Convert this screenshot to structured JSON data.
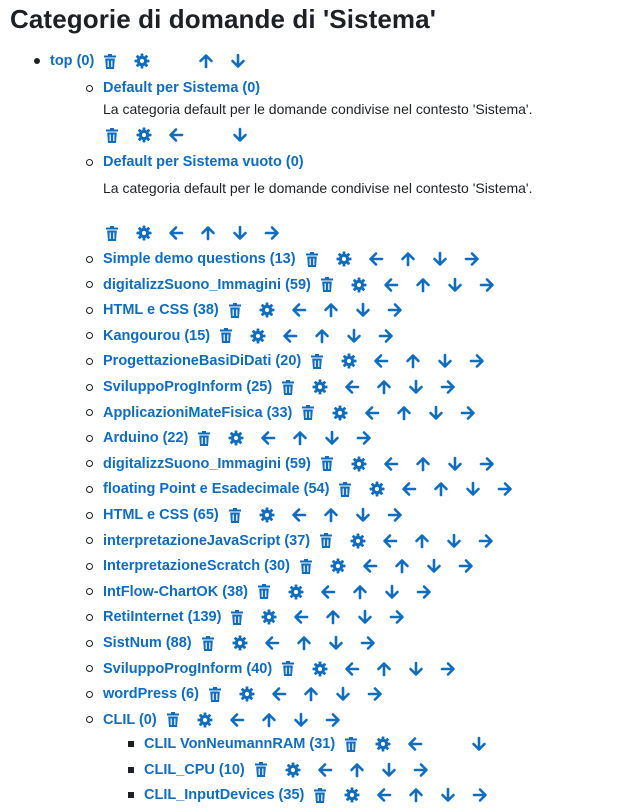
{
  "page": {
    "title": "Categorie di domande di 'Sistema'"
  },
  "colors": {
    "link": "#0f6cbf",
    "text": "#1d2125"
  },
  "top": {
    "label": "top (0)",
    "actions": [
      "delete",
      "settings",
      "",
      "up",
      "down"
    ]
  },
  "defaults": [
    {
      "label": "Default per Sistema (0)",
      "description": "La categoria default per le domande condivise nel contesto 'Sistema'.",
      "actions": [
        "delete",
        "settings",
        "left",
        "",
        "down"
      ]
    },
    {
      "label": "Default per Sistema vuoto (0)",
      "description": "La categoria default per le domande condivise nel contesto 'Sistema'.",
      "actions": [
        "delete",
        "settings",
        "left",
        "up",
        "down",
        "right"
      ]
    }
  ],
  "categories": [
    {
      "label": "Simple demo questions (13)",
      "actions": [
        "delete",
        "settings",
        "left",
        "up",
        "down",
        "right"
      ]
    },
    {
      "label": "digitalizzSuono_Immagini (59)",
      "actions": [
        "delete",
        "settings",
        "left",
        "up",
        "down",
        "right"
      ]
    },
    {
      "label": "HTML e CSS (38)",
      "actions": [
        "delete",
        "settings",
        "left",
        "up",
        "down",
        "right"
      ]
    },
    {
      "label": "Kangourou (15)",
      "actions": [
        "delete",
        "settings",
        "left",
        "up",
        "down",
        "right"
      ]
    },
    {
      "label": "ProgettazioneBasiDiDati (20)",
      "actions": [
        "delete",
        "settings",
        "left",
        "up",
        "down",
        "right"
      ]
    },
    {
      "label": "SviluppoProgInform (25)",
      "actions": [
        "delete",
        "settings",
        "left",
        "up",
        "down",
        "right"
      ]
    },
    {
      "label": "ApplicazioniMateFisica (33)",
      "actions": [
        "delete",
        "settings",
        "left",
        "up",
        "down",
        "right"
      ]
    },
    {
      "label": "Arduino (22)",
      "actions": [
        "delete",
        "settings",
        "left",
        "up",
        "down",
        "right"
      ]
    },
    {
      "label": "digitalizzSuono_Immagini (59)",
      "actions": [
        "delete",
        "settings",
        "left",
        "up",
        "down",
        "right"
      ]
    },
    {
      "label": "floating Point e Esadecimale (54)",
      "actions": [
        "delete",
        "settings",
        "left",
        "up",
        "down",
        "right"
      ]
    },
    {
      "label": "HTML e CSS (65)",
      "actions": [
        "delete",
        "settings",
        "left",
        "up",
        "down",
        "right"
      ]
    },
    {
      "label": "interpretazioneJavaScript (37)",
      "actions": [
        "delete",
        "settings",
        "left",
        "up",
        "down",
        "right"
      ]
    },
    {
      "label": "InterpretazioneScratch (30)",
      "actions": [
        "delete",
        "settings",
        "left",
        "up",
        "down",
        "right"
      ]
    },
    {
      "label": "IntFlow-ChartOK (38)",
      "actions": [
        "delete",
        "settings",
        "left",
        "up",
        "down",
        "right"
      ]
    },
    {
      "label": "RetiInternet (139)",
      "actions": [
        "delete",
        "settings",
        "left",
        "up",
        "down",
        "right"
      ]
    },
    {
      "label": "SistNum (88)",
      "actions": [
        "delete",
        "settings",
        "left",
        "up",
        "down",
        "right"
      ]
    },
    {
      "label": "SviluppoProgInform (40)",
      "actions": [
        "delete",
        "settings",
        "left",
        "up",
        "down",
        "right"
      ]
    },
    {
      "label": "wordPress (6)",
      "actions": [
        "delete",
        "settings",
        "left",
        "up",
        "down",
        "right"
      ]
    },
    {
      "label": "CLIL (0)",
      "actions": [
        "delete",
        "settings",
        "left",
        "up",
        "down",
        "right"
      ]
    }
  ],
  "subcategories": [
    {
      "label": "CLIL VonNeumannRAM (31)",
      "actions": [
        "delete",
        "settings",
        "left",
        "",
        "down"
      ]
    },
    {
      "label": "CLIL_CPU (10)",
      "actions": [
        "delete",
        "settings",
        "left",
        "up",
        "down",
        "right"
      ]
    },
    {
      "label": "CLIL_InputDevices (35)",
      "actions": [
        "delete",
        "settings",
        "left",
        "up",
        "down",
        "right"
      ]
    }
  ]
}
